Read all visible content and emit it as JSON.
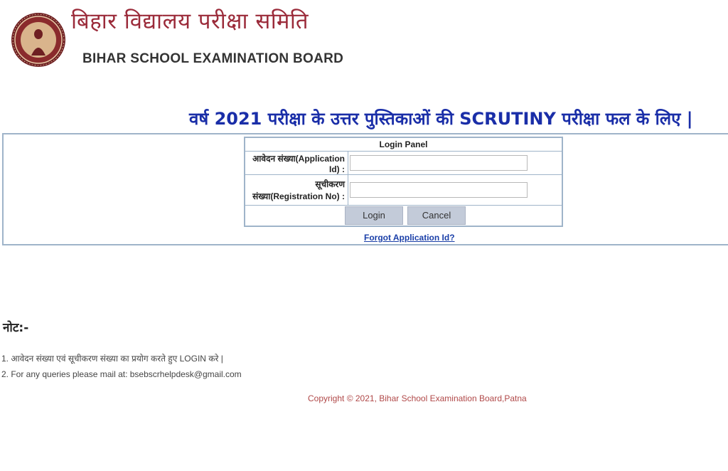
{
  "header": {
    "org_hindi": "बिहार विद्यालय परीक्षा समिति",
    "org_english": "BIHAR SCHOOL EXAMINATION BOARD",
    "logo_icon": "bseb-emblem-icon"
  },
  "banner": {
    "title": "वर्ष 2021 परीक्षा के उत्तर पुस्तिकाओं की SCRUTINY परीक्षा फल के लिए |"
  },
  "login_panel": {
    "title": "Login Panel",
    "application_id_label": "आवेदन संख्या(Application Id) :",
    "application_id_value": "",
    "registration_label": "सूचीकरण संख्या(Registration No) :",
    "registration_value": "",
    "login_button": "Login",
    "cancel_button": "Cancel",
    "forgot_link": "Forgot Application Id?"
  },
  "notes": {
    "heading": "नोट:-",
    "items": [
      "1. आवेदन संख्या एवं सूचीकरण संख्या का प्रयोग करते हुए LOGIN करे |",
      "2. For any queries please mail at: bsebscrhelpdesk@gmail.com"
    ]
  },
  "footer": {
    "copyright": "Copyright © 2021, Bihar School Examination Board,Patna"
  },
  "colors": {
    "brand_maroon": "#9b2b3a",
    "banner_blue": "#1a2ea8",
    "border": "#9fb4c9",
    "button": "#c3cbd9",
    "copyright": "#b04848"
  }
}
